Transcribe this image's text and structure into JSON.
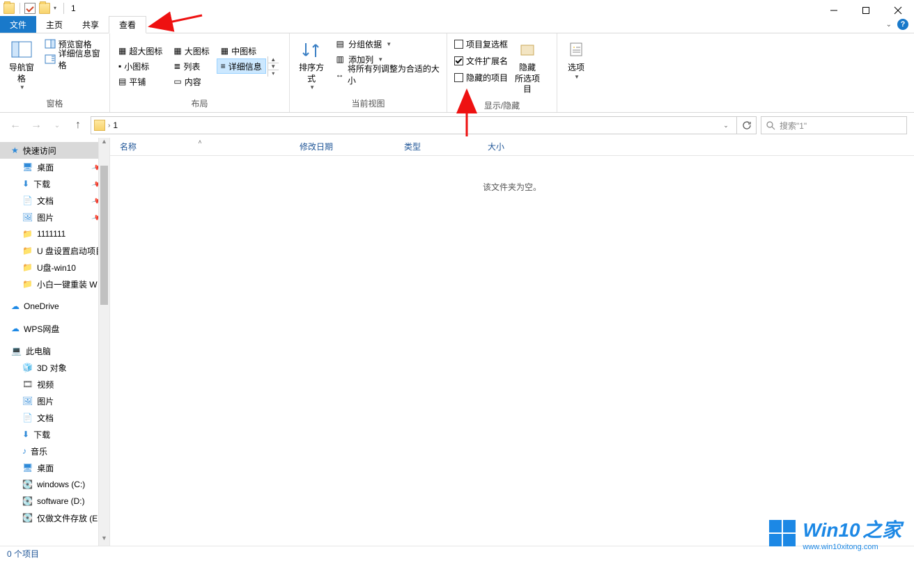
{
  "window": {
    "title": "1"
  },
  "menu": {
    "file": "文件",
    "home": "主页",
    "share": "共享",
    "view": "查看"
  },
  "ribbon": {
    "panes": {
      "label": "窗格",
      "nav_pane": "导航窗格",
      "preview_pane": "预览窗格",
      "details_pane": "详细信息窗格"
    },
    "layout": {
      "label": "布局",
      "extra_large": "超大图标",
      "large": "大图标",
      "medium": "中图标",
      "small": "小图标",
      "list": "列表",
      "details": "详细信息",
      "tiles": "平铺",
      "content": "内容"
    },
    "current_view": {
      "label": "当前视图",
      "sort": "排序方式",
      "group_by": "分组依据",
      "add_columns": "添加列",
      "fit_columns": "将所有列调整为合适的大小"
    },
    "show_hide": {
      "label": "显示/隐藏",
      "item_checkboxes": "项目复选框",
      "file_ext": "文件扩展名",
      "hidden_items": "隐藏的项目",
      "hide_btn": "隐藏",
      "hide_btn_sub": "所选项目"
    },
    "options": {
      "options": "选项"
    }
  },
  "address": {
    "crumb": "1"
  },
  "search": {
    "placeholder": "搜索\"1\""
  },
  "columns": {
    "name": "名称",
    "modified": "修改日期",
    "type": "类型",
    "size": "大小"
  },
  "content_area": {
    "empty": "该文件夹为空。"
  },
  "sidebar": {
    "quick_access": "快速访问",
    "items_quick": [
      "桌面",
      "下载",
      "文档",
      "图片",
      "1111111",
      "U 盘设置启动项目",
      "U盘-win10",
      "小白一键重装 W"
    ],
    "onedrive": "OneDrive",
    "wps": "WPS网盘",
    "this_pc": "此电脑",
    "pc_items": [
      "3D 对象",
      "视频",
      "图片",
      "文档",
      "下载",
      "音乐",
      "桌面",
      "windows (C:)",
      "software (D:)",
      "仅做文件存放 (E"
    ]
  },
  "status": {
    "items": "0 个项目"
  },
  "watermark": {
    "title": "Win10",
    "suffix": "之家",
    "url": "www.win10xitong.com"
  }
}
